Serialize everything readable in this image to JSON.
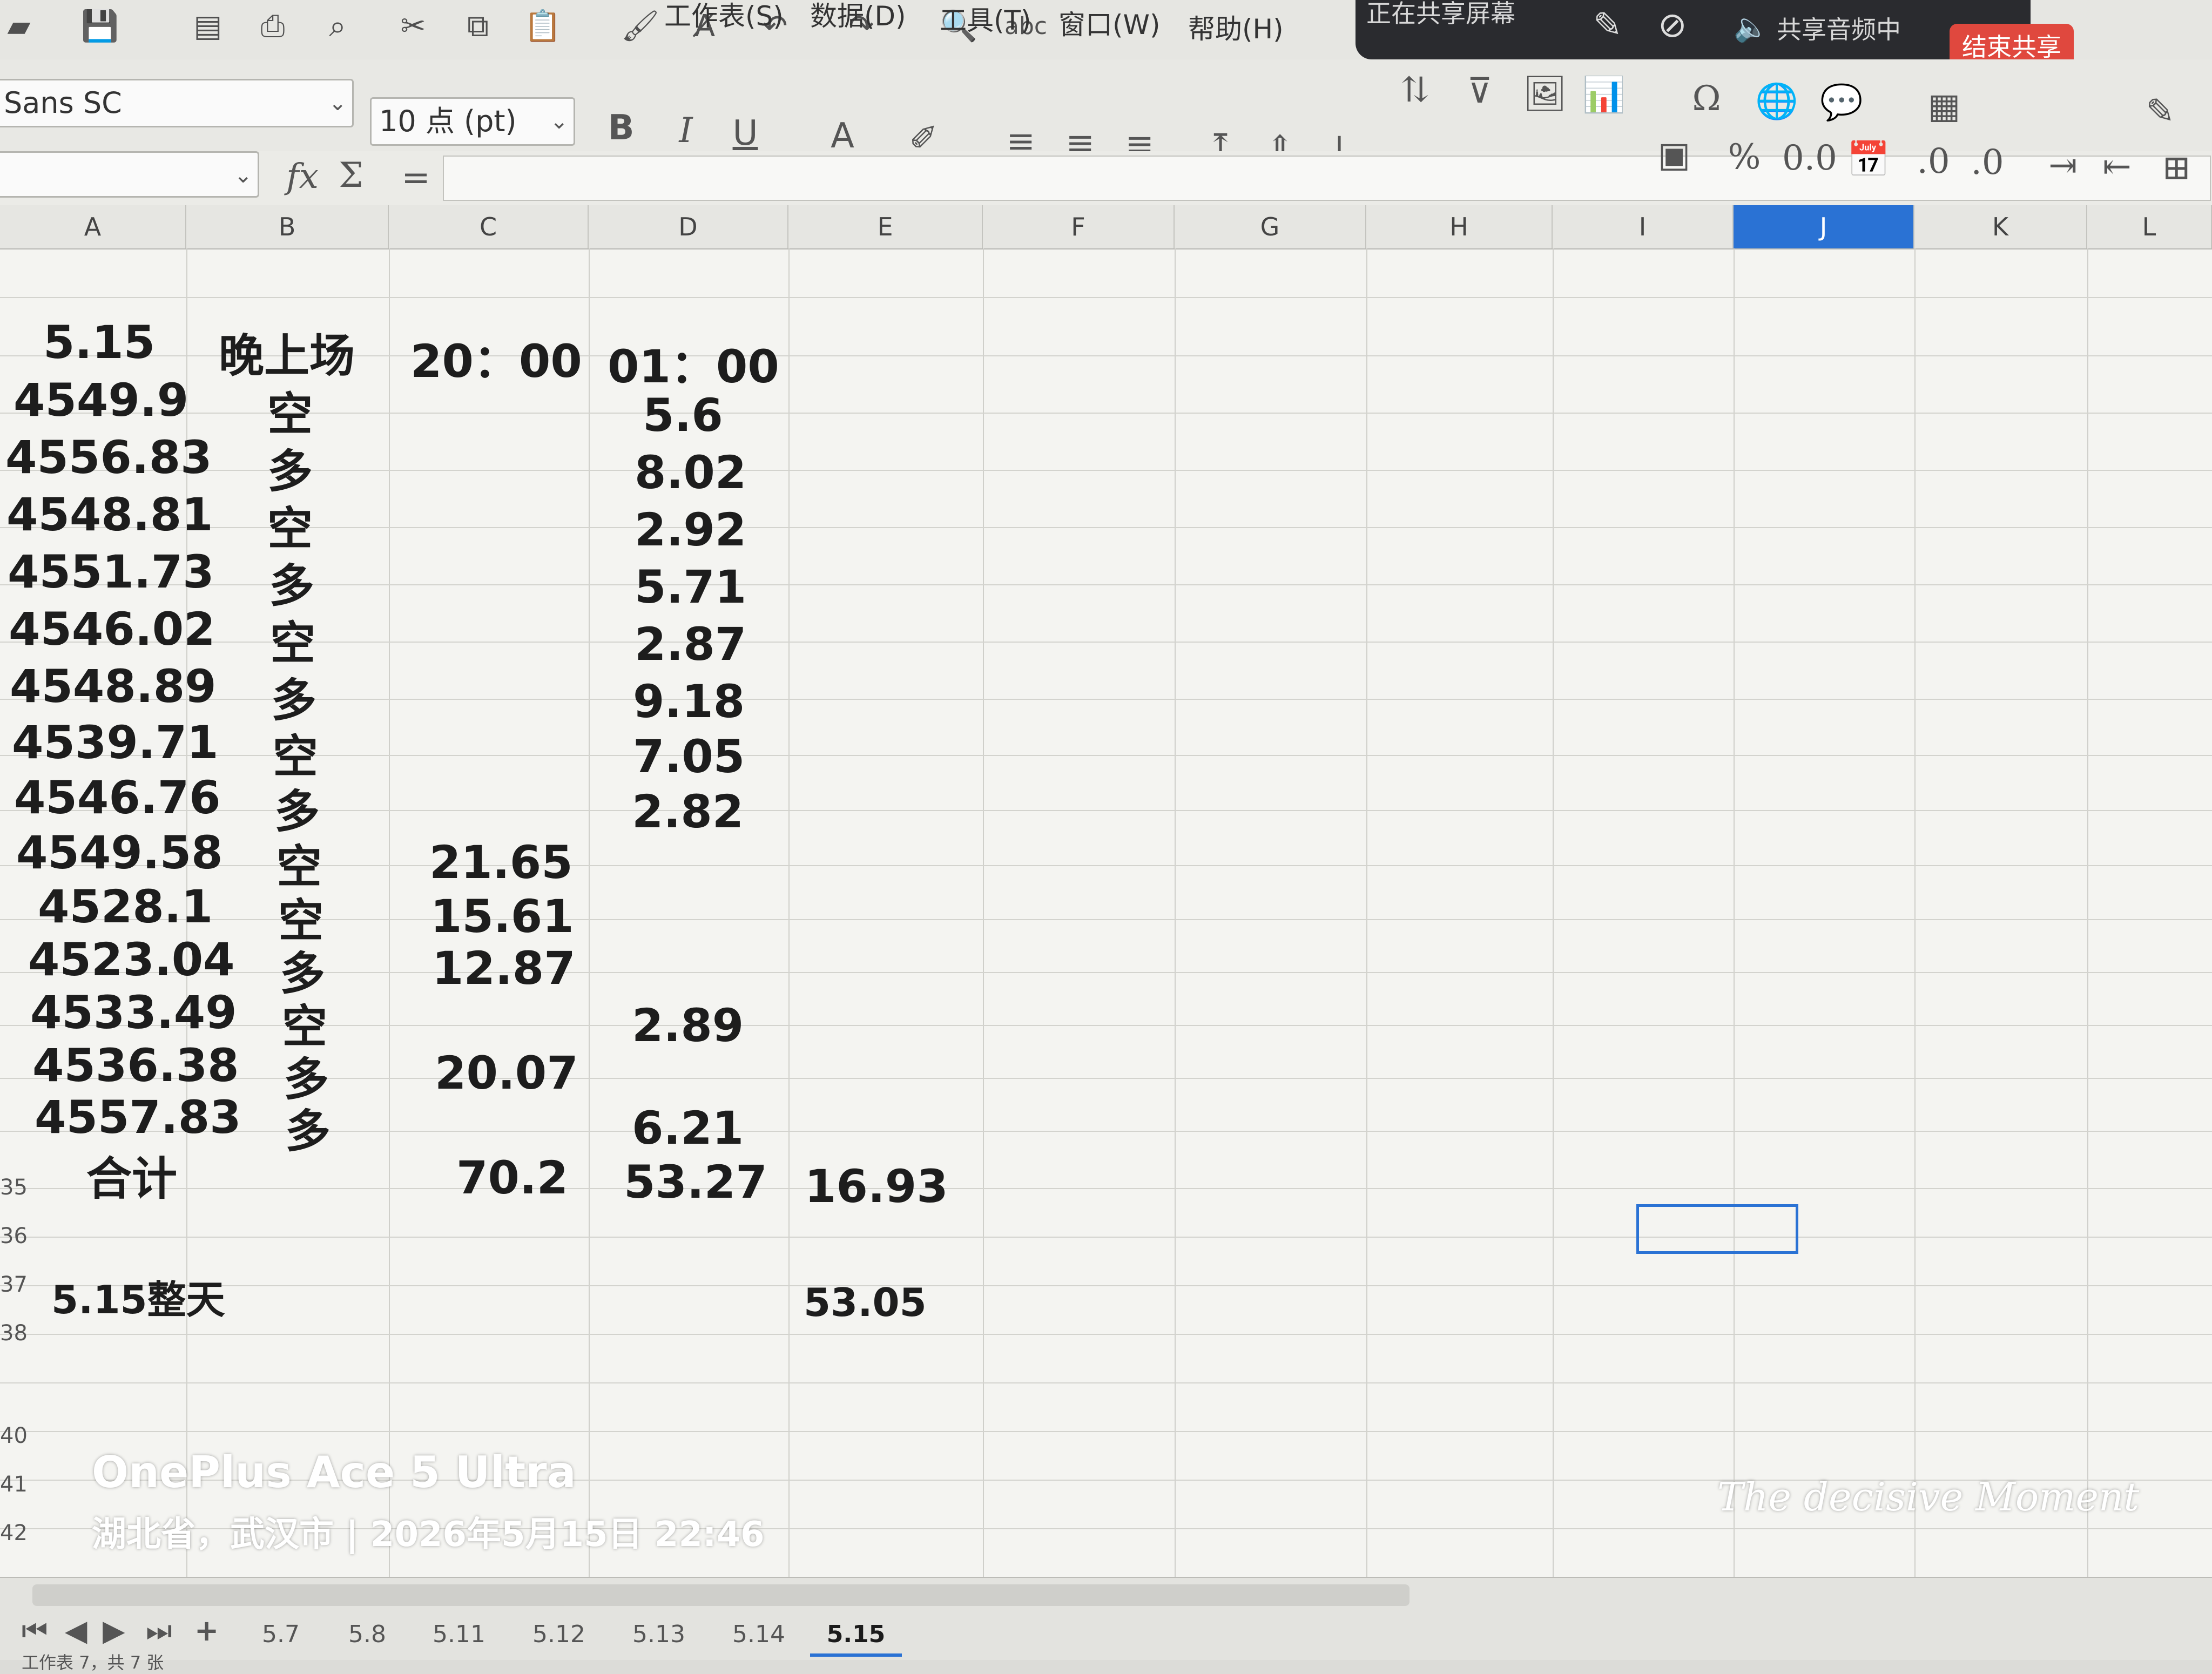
{
  "menu": {
    "items": [
      "工作表(S)",
      "数据(D)",
      "工具(T)",
      "窗口(W)",
      "帮助(H)"
    ]
  },
  "share": {
    "status": "正在共享屏幕",
    "audio": "共享音频中",
    "end_label": "结束共享"
  },
  "format": {
    "font_name": "Sans SC",
    "font_size": "10 点 (pt)",
    "percent_label": "%",
    "decimal_label": "0.0"
  },
  "columns": [
    "A",
    "B",
    "C",
    "D",
    "E",
    "F",
    "G",
    "H",
    "I",
    "J",
    "K",
    "L"
  ],
  "selected_column": "J",
  "header_row": {
    "date": "5.15",
    "session": "晚上场",
    "start_time": "20：00",
    "end_time": "01：00"
  },
  "rows": [
    {
      "a": "4549.9",
      "b": "空",
      "c": "",
      "d": "5.6"
    },
    {
      "a": "4556.83",
      "b": "多",
      "c": "",
      "d": "8.02"
    },
    {
      "a": "4548.81",
      "b": "空",
      "c": "",
      "d": "2.92"
    },
    {
      "a": "4551.73",
      "b": "多",
      "c": "",
      "d": "5.71"
    },
    {
      "a": "4546.02",
      "b": "空",
      "c": "",
      "d": "2.87"
    },
    {
      "a": "4548.89",
      "b": "多",
      "c": "",
      "d": "9.18"
    },
    {
      "a": "4539.71",
      "b": "空",
      "c": "",
      "d": "7.05"
    },
    {
      "a": "4546.76",
      "b": "多",
      "c": "",
      "d": "2.82"
    },
    {
      "a": "4549.58",
      "b": "空",
      "c": "21.65",
      "d": ""
    },
    {
      "a": "4528.1",
      "b": "空",
      "c": "15.61",
      "d": ""
    },
    {
      "a": "4523.04",
      "b": "多",
      "c": "12.87",
      "d": ""
    },
    {
      "a": "4533.49",
      "b": "空",
      "c": "",
      "d": "2.89"
    },
    {
      "a": "4536.38",
      "b": "多",
      "c": "20.07",
      "d": ""
    },
    {
      "a": "4557.83",
      "b": "多",
      "c": "",
      "d": "6.21"
    }
  ],
  "total_row": {
    "label": "合计",
    "c": "70.2",
    "d": "53.27",
    "e": "16.93",
    "row_num": "35"
  },
  "day_row": {
    "label": "5.15整天",
    "e": "53.05",
    "row_num": "37"
  },
  "row_numbers": [
    "36",
    "38",
    "40",
    "41",
    "42"
  ],
  "sheet_tabs": [
    "5.7",
    "5.8",
    "5.11",
    "5.12",
    "5.13",
    "5.14",
    "5.15"
  ],
  "active_tab": "5.15",
  "status": {
    "text": "工作表 7，共 7 张"
  },
  "watermark": {
    "device": "OnePlus Ace 5 Ultra",
    "location_time": "湖北省，武汉市 | 2026年5月15日 22:46",
    "signature": "The decisive Moment"
  }
}
